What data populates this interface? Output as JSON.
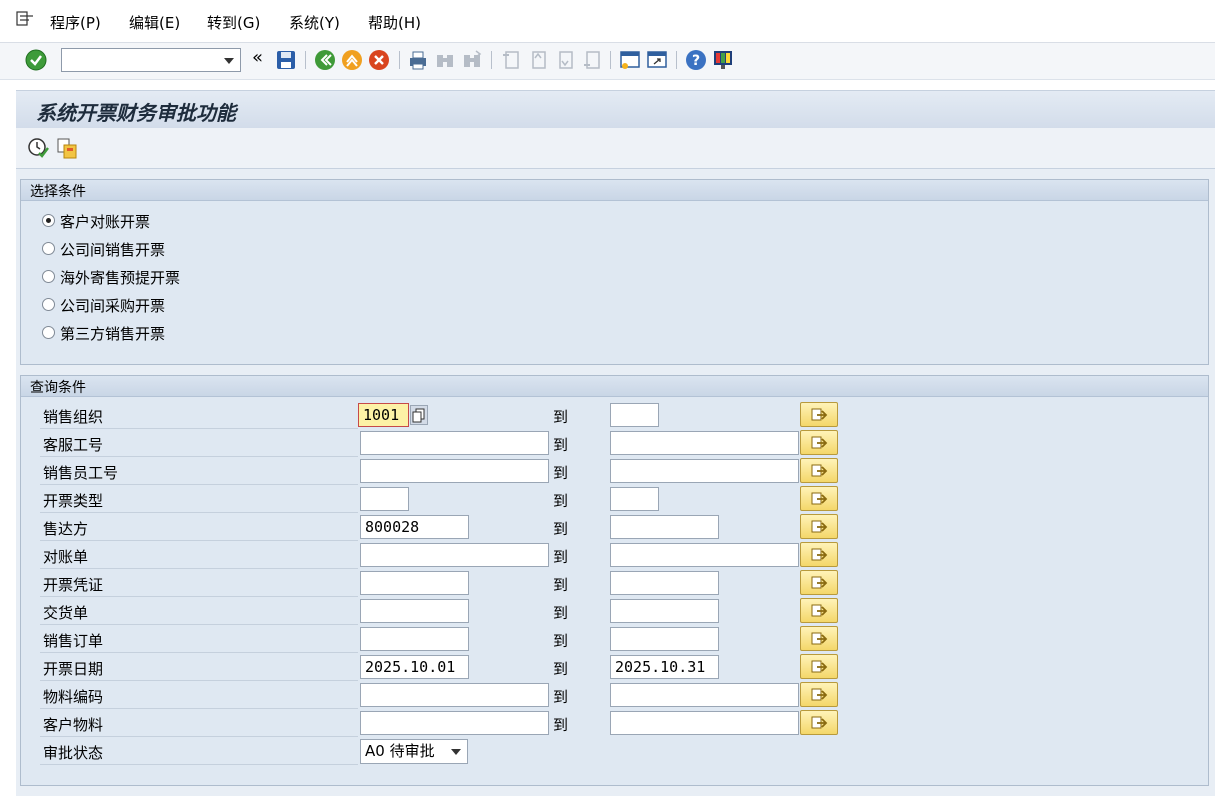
{
  "menubar": {
    "items": [
      "程序(P)",
      "编辑(E)",
      "转到(G)",
      "系统(Y)",
      "帮助(H)"
    ]
  },
  "toolbar": {
    "command_value": "",
    "back_chevrons": "«"
  },
  "title": "系统开票财务审批功能",
  "selection": {
    "header": "选择条件",
    "options": [
      {
        "label": "客户对账开票",
        "selected": true
      },
      {
        "label": "公司间销售开票",
        "selected": false
      },
      {
        "label": "海外寄售预提开票",
        "selected": false
      },
      {
        "label": "公司间采购开票",
        "selected": false
      },
      {
        "label": "第三方销售开票",
        "selected": false
      }
    ]
  },
  "query": {
    "header": "查询条件",
    "to_label": "到",
    "rows": [
      {
        "label": "销售组织",
        "from": "1001",
        "to": ""
      },
      {
        "label": "客服工号",
        "from": "",
        "to": ""
      },
      {
        "label": "销售员工号",
        "from": "",
        "to": ""
      },
      {
        "label": "开票类型",
        "from": "",
        "to": ""
      },
      {
        "label": "售达方",
        "from": "800028",
        "to": ""
      },
      {
        "label": "对账单",
        "from": "",
        "to": ""
      },
      {
        "label": "开票凭证",
        "from": "",
        "to": ""
      },
      {
        "label": "交货单",
        "from": "",
        "to": ""
      },
      {
        "label": "销售订单",
        "from": "",
        "to": ""
      },
      {
        "label": "开票日期",
        "from": "2025.10.01",
        "to": "2025.10.31"
      },
      {
        "label": "物料编码",
        "from": "",
        "to": ""
      },
      {
        "label": "客户物料",
        "from": "",
        "to": ""
      }
    ],
    "status": {
      "label": "审批状态",
      "value": "A0 待审批"
    }
  },
  "colors": {
    "accent_yellow": "#f4d76a",
    "highlight_field": "#fdf2a6",
    "content_bg": "#e8eef5"
  }
}
